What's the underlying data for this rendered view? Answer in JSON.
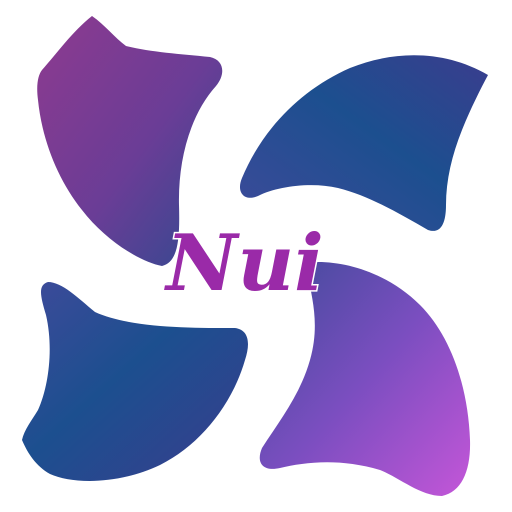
{
  "logo": {
    "wordmark": "Nui",
    "wordmark_color": "#9a2aa8",
    "colors": {
      "magenta": "#8e3a8f",
      "purple": "#6a3d96",
      "navy": "#1c4f8f",
      "indigo": "#3a3d8e",
      "violet": "#7b4ec0",
      "orchid": "#c456d8",
      "background": "#ffffff"
    }
  }
}
